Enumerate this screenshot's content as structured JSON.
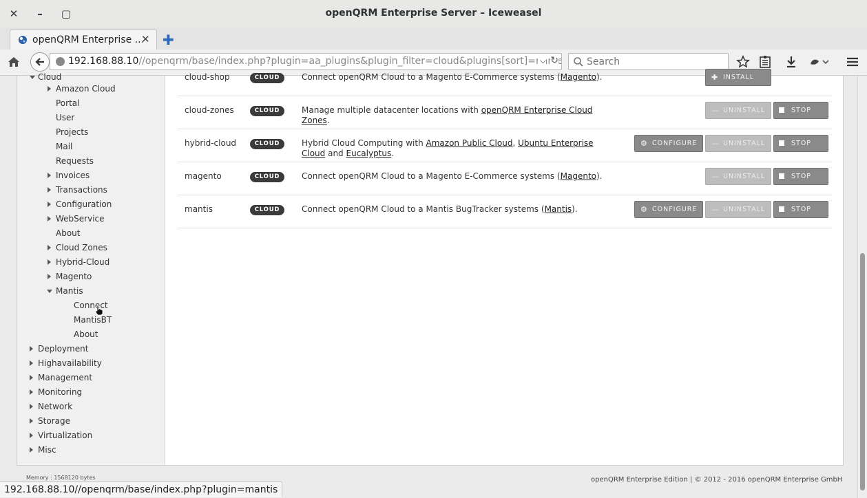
{
  "window": {
    "title": "openQRM Enterprise Server – Iceweasel",
    "close_glyph": "✕",
    "minimize_glyph": "–",
    "maximize_glyph": "▢"
  },
  "tabs": [
    {
      "title": "openQRM Enterprise ...",
      "close_glyph": "✕"
    }
  ],
  "new_tab_glyph": "✚",
  "navbar": {
    "url_host": "192.168.88.10",
    "url_path": "//openqrm/base/index.php?plugin=aa_plugins&plugin_filter=cloud&plugins[sort]=name&p",
    "url_dropdown_glyph": "⌵",
    "reload_glyph": "↻",
    "search_placeholder": "Search"
  },
  "sidebar": {
    "cloud_label": "Cloud",
    "cloud_children": [
      {
        "label": "Amazon Cloud",
        "expandable": true
      },
      {
        "label": "Portal",
        "expandable": false
      },
      {
        "label": "User",
        "expandable": false
      },
      {
        "label": "Projects",
        "expandable": false
      },
      {
        "label": "Mail",
        "expandable": false
      },
      {
        "label": "Requests",
        "expandable": false
      },
      {
        "label": "Invoices",
        "expandable": true
      },
      {
        "label": "Transactions",
        "expandable": true
      },
      {
        "label": "Configuration",
        "expandable": true
      },
      {
        "label": "WebService",
        "expandable": true
      },
      {
        "label": "About",
        "expandable": false
      },
      {
        "label": "Cloud Zones",
        "expandable": true
      },
      {
        "label": "Hybrid-Cloud",
        "expandable": true
      },
      {
        "label": "Magento",
        "expandable": true
      },
      {
        "label": "Mantis",
        "expandable": true,
        "expanded": true
      }
    ],
    "mantis_children": [
      "Connect",
      "MantisBT",
      "About"
    ],
    "top_level": [
      "Deployment",
      "Highavailability",
      "Management",
      "Monitoring",
      "Network",
      "Storage",
      "Virtualization",
      "Misc"
    ]
  },
  "plugins": {
    "badge_label": "CLOUD",
    "partial_row": {
      "name": "cloud-shop",
      "desc_prefix": "Connect openQRM Cloud to a Magento E-Commerce systems (",
      "desc_link": "Magento",
      "desc_suffix": ")."
    },
    "rows": [
      {
        "name": "cloud-zones",
        "desc_prefix": "Manage multiple datacenter locations with ",
        "desc_link": "openQRM Enterprise Cloud Zones",
        "desc_suffix": "."
      },
      {
        "name": "hybrid-cloud",
        "desc_prefix": "Hybrid Cloud Computing with ",
        "desc_link1": "Amazon Public Cloud",
        "desc_mid1": ", ",
        "desc_link2": "Ubuntu Enterprise Cloud",
        "desc_mid2": " and ",
        "desc_link3": "Eucalyptus",
        "desc_suffix": "."
      },
      {
        "name": "magento",
        "desc_prefix": "Connect openQRM Cloud to a Magento E-Commerce systems (",
        "desc_link": "Magento",
        "desc_suffix": ")."
      },
      {
        "name": "mantis",
        "desc_prefix": "Connect openQRM Cloud to a Mantis BugTracker systems (",
        "desc_link": "Mantis",
        "desc_suffix": ")."
      }
    ],
    "buttons": {
      "install": "INSTALL",
      "install_glyph": "✚",
      "uninstall": "UNINSTALL",
      "uninstall_glyph": "—",
      "stop": "STOP",
      "configure": "CONFIGURE",
      "configure_glyph": "⚙"
    }
  },
  "footer": {
    "memory": "Memory : 1568120 bytes",
    "copyright": "openQRM Enterprise Edition | © 2012 - 2016 openQRM Enterprise GmbH"
  },
  "status_url": "192.168.88.10//openqrm/base/index.php?plugin=mantis",
  "colors": {
    "badge": "#3a3a3a",
    "button": "#8a8a8a",
    "button_disabled": "#bdbdbd",
    "sidebar_bg": "#f0f0f0"
  }
}
